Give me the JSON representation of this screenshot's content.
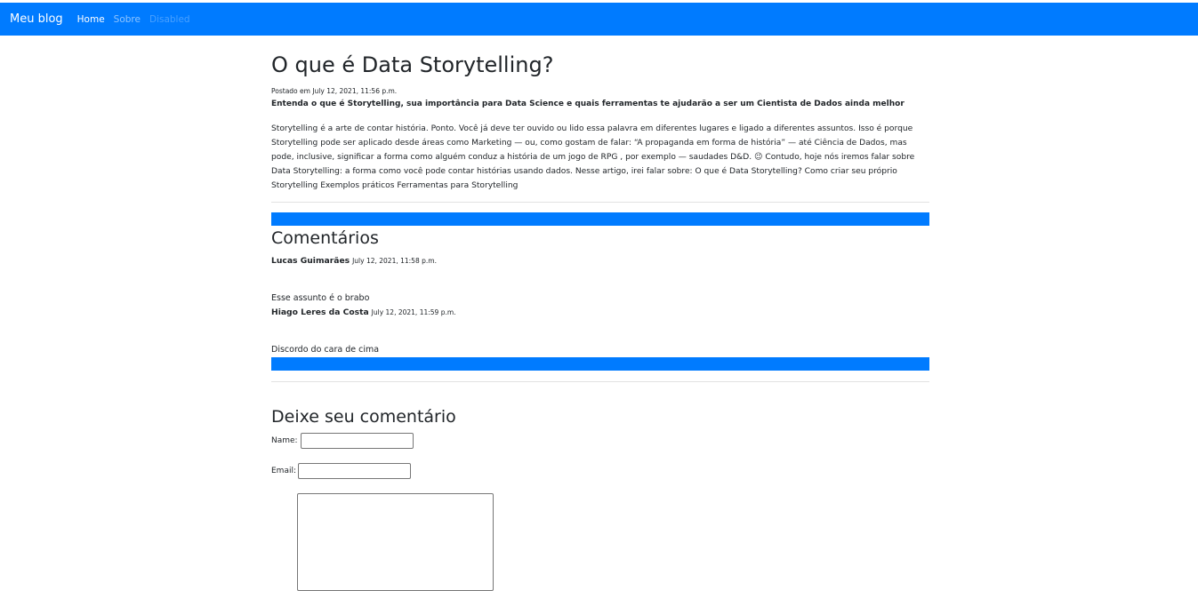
{
  "navbar": {
    "brand": "Meu blog",
    "links": [
      {
        "label": "Home",
        "state": "active"
      },
      {
        "label": "Sobre",
        "state": "normal"
      },
      {
        "label": "Disabled",
        "state": "disabled"
      }
    ],
    "color": "#007bff"
  },
  "post": {
    "title": "O que é Data Storytelling?",
    "date": "Postado em July 12, 2021, 11:56 p.m.",
    "subtitle": "Entenda o que é Storytelling, sua importância para Data Science e quais ferramentas te ajudarão a ser um Cientista de Dados ainda melhor",
    "body": "Storytelling é a arte de contar história. Ponto. Você já deve ter ouvido ou lido essa palavra em diferentes lugares e ligado a diferentes assuntos. Isso é porque Storytelling pode ser aplicado desde áreas como Marketing — ou, como gostam de falar: “A propaganda em forma de história” — até Ciência de Dados, mas pode, inclusive, significar a forma como alguém conduz a história de um jogo de RPG , por exemplo — saudades D&D. 😉 Contudo, hoje nós iremos falar sobre Data Storytelling: a forma como você pode contar histórias usando dados. Nesse artigo, irei falar sobre: O que é Data Storytelling? Como criar seu próprio Storytelling Exemplos práticos Ferramentas para Storytelling"
  },
  "comments": {
    "title": "Comentários",
    "items": [
      {
        "author": "Lucas Guimarães",
        "date": "July 12, 2021, 11:58 p.m.",
        "text": "Esse assunto é o brabo"
      },
      {
        "author": "Hiago Leres da Costa",
        "date": "July 12, 2021, 11:59 p.m.",
        "text": "Discordo do cara de cima"
      }
    ]
  },
  "comment_form": {
    "title": "Deixe seu comentário",
    "name_label": "Name:",
    "name_value": "",
    "email_label": "Email:",
    "email_value": "",
    "body_value": ""
  }
}
